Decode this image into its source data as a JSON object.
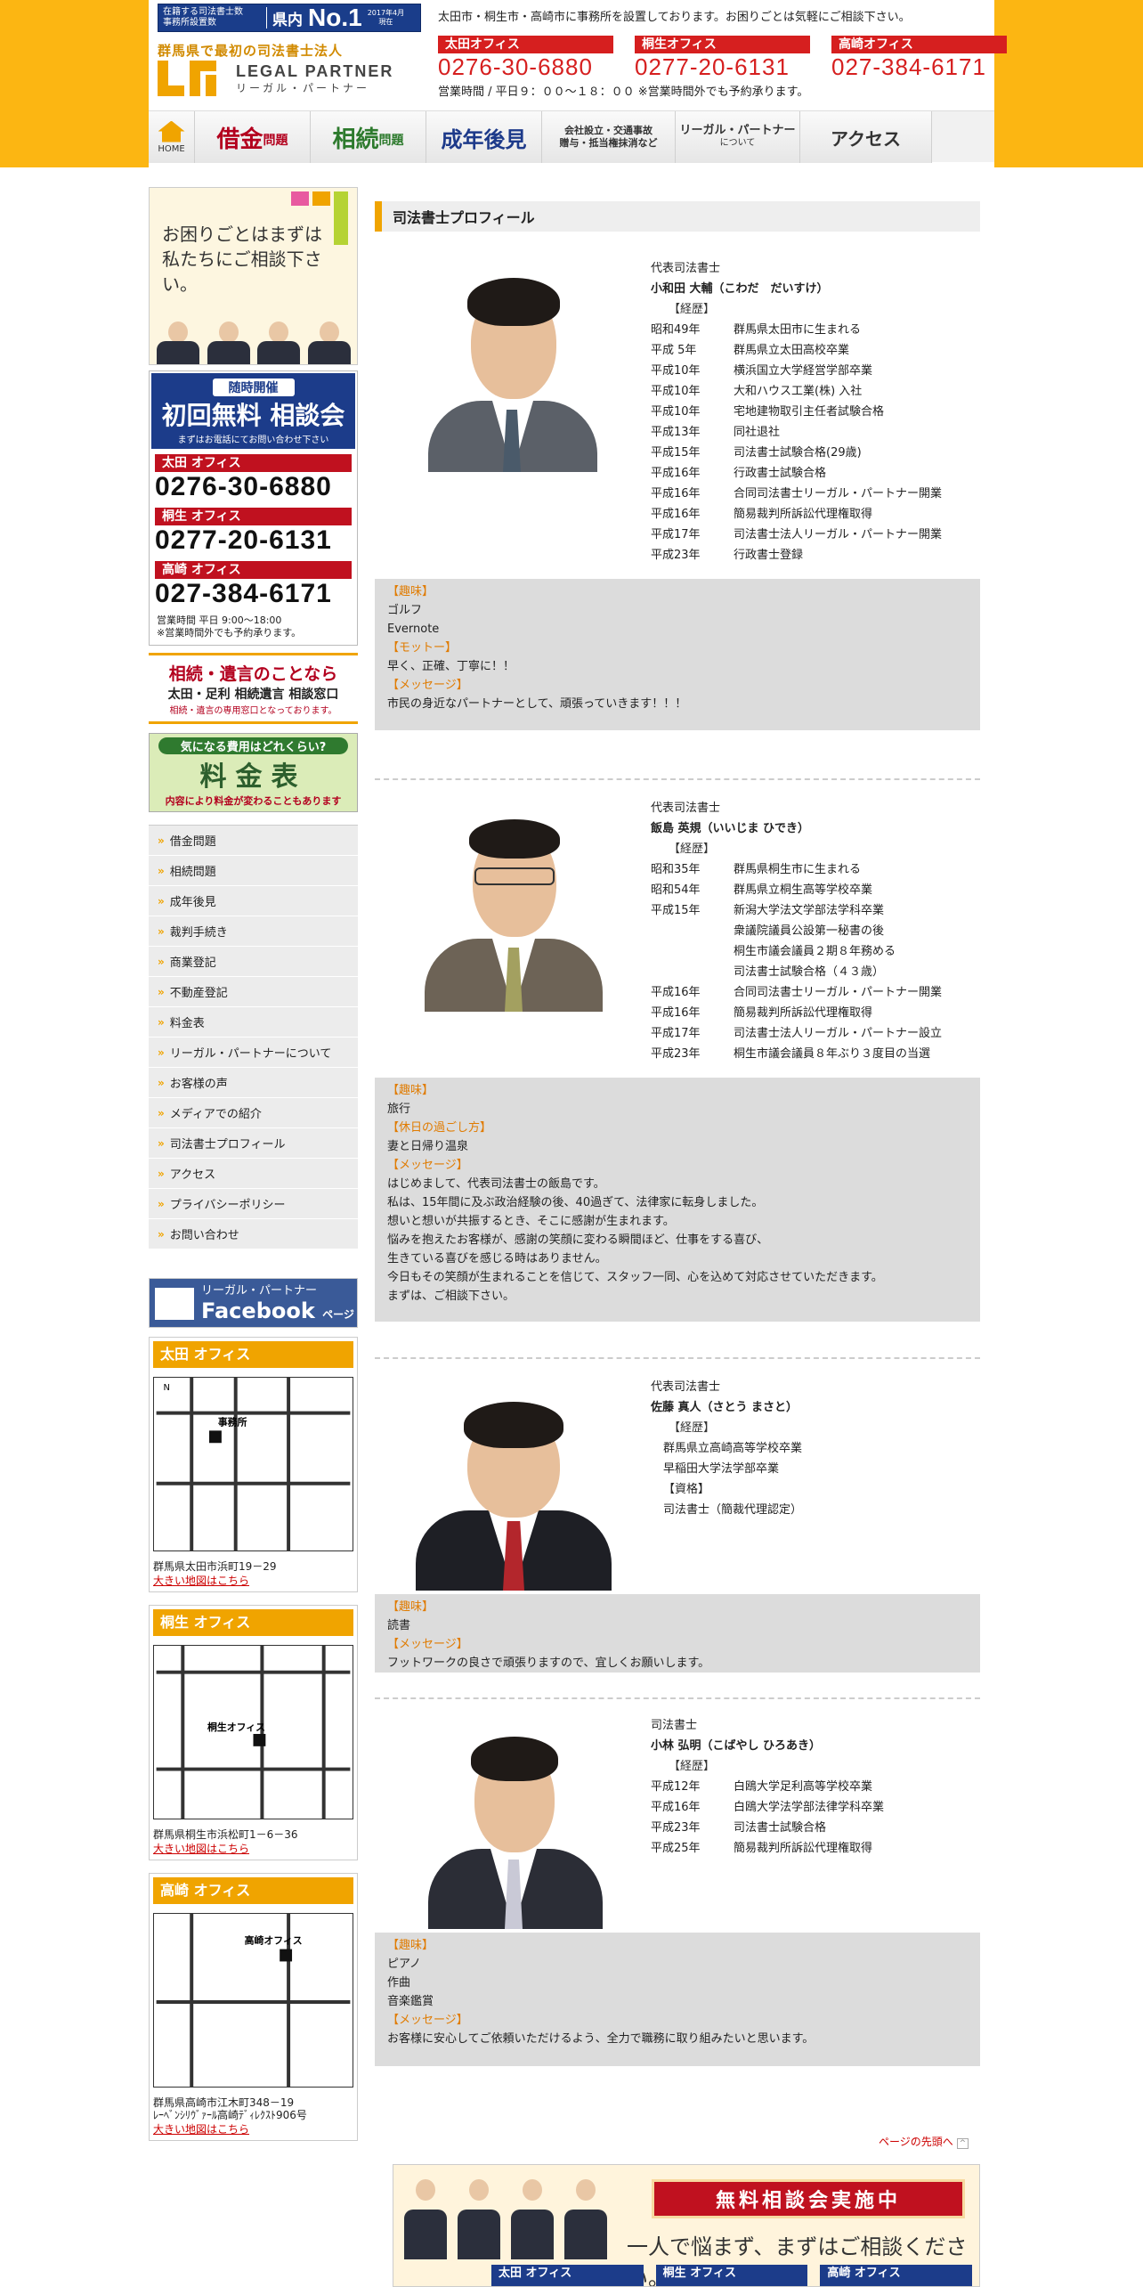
{
  "header": {
    "badge_left": "在籍する司法書士数\n事務所設置数",
    "badge_pref": "県内",
    "badge_no1": "No.1",
    "badge_date": "2017年4月\n現在",
    "tagline": "群馬県で最初の司法書士法人",
    "logo_en": "LEGAL PARTNER",
    "logo_ja": "リーガル・パートナー",
    "notice": "太田市・桐生市・高崎市に事務所を設置しております。お困りごとは気軽にご相談下さい。",
    "offices": [
      {
        "label": "太田オフィス",
        "tel": "0276-30-6880"
      },
      {
        "label": "桐生オフィス",
        "tel": "0277-20-6131"
      },
      {
        "label": "高崎オフィス",
        "tel": "027-384-6171"
      }
    ],
    "hours": "営業時間 / 平日９：００～１８：００ ※営業時間外でも予約承ります。"
  },
  "nav": {
    "home": "HOME",
    "debt": "借金",
    "debt_sub": "問題",
    "inherit": "相続",
    "inherit_sub": "問題",
    "guardian": "成年後見",
    "corp": "会社設立・交通事故\n贈与・抵当権抹消など",
    "about": "リーガル・パートナー",
    "about_sub": "について",
    "access": "アクセス"
  },
  "sidebar": {
    "consult_q": "お困りごとはまずは\n私たちにご相談下さい。",
    "free_a": "随時開催",
    "free_b": "初回無料 相談会",
    "free_c": "まずはお電話にてお問い合わせ下さい",
    "offices": [
      {
        "label": "太田 オフィス",
        "tel": "0276-30-6880"
      },
      {
        "label": "桐生 オフィス",
        "tel": "0277-20-6131"
      },
      {
        "label": "高崎 オフィス",
        "tel": "027-384-6171"
      }
    ],
    "hours": "営業時間 平日 9:00〜18:00\n※営業時間外でも予約承ります。",
    "souzoku_a": "相続・遺言のことなら",
    "souzoku_b": "太田・足利 相続遺言 相談窓口",
    "souzoku_c": "相続・遺言の専用窓口となっております。",
    "fee_a": "気になる費用はどれくらい?",
    "fee_b": "料金表",
    "fee_c": "内容により料金が変わることもあります",
    "menu": [
      "借金問題",
      "相続問題",
      "成年後見",
      "裁判手続き",
      "商業登記",
      "不動産登記",
      "料金表",
      "リーガル・パートナーについて",
      "お客様の声",
      "メディアでの紹介",
      "司法書士プロフィール",
      "アクセス",
      "プライバシーポリシー",
      "お問い合わせ"
    ],
    "fb_a": "リーガル・パートナー",
    "fb_b": "Facebook",
    "fb_c": "ページ",
    "maps": [
      {
        "title": "太田 オフィス",
        "addr": "群馬県太田市浜町19－29",
        "link": "大きい地図はこちら"
      },
      {
        "title": "桐生 オフィス",
        "addr": "群馬県桐生市浜松町1－6－36",
        "link": "大きい地図はこちら"
      },
      {
        "title": "高崎 オフィス",
        "addr": "群馬県高崎市江木町348－19\nﾚｰﾍﾞﾝｼﾘｳﾞｧｰﾙ高崎ﾃﾞｨﾚｸｽﾄ906号",
        "link": "大きい地図はこちら"
      }
    ]
  },
  "main": {
    "title": "司法書士プロフィール",
    "profiles": [
      {
        "role": "代表司法書士",
        "name": "小和田 大輔（こわだ　だいすけ）",
        "hist_label": "【経歴】",
        "history": [
          [
            "昭和49年",
            "群馬県太田市に生まれる"
          ],
          [
            "平成 5年",
            "群馬県立太田高校卒業"
          ],
          [
            "平成10年",
            "横浜国立大学経営学部卒業"
          ],
          [
            "平成10年",
            "大和ハウス工業(株) 入社"
          ],
          [
            "平成10年",
            "宅地建物取引主任者試験合格"
          ],
          [
            "平成13年",
            "同社退社"
          ],
          [
            "平成15年",
            "司法書士試験合格(29歳)"
          ],
          [
            "平成16年",
            "行政書士試験合格"
          ],
          [
            "平成16年",
            "合同司法書士リーガル・パートナー開業"
          ],
          [
            "平成16年",
            "簡易裁判所訴訟代理権取得"
          ],
          [
            "平成17年",
            "司法書士法人リーガル・パートナー開業"
          ],
          [
            "平成23年",
            "行政書士登録"
          ]
        ],
        "extra": [
          {
            "k": "【趣味】"
          },
          {
            "v": "ゴルフ"
          },
          {
            "v": "Evernote"
          },
          {
            "k": "【モットー】"
          },
          {
            "v": "早く、正確、丁寧に！！"
          },
          {
            "k": "【メッセージ】"
          },
          {
            "v": "市民の身近なパートナーとして、頑張っていきます！！！"
          }
        ]
      },
      {
        "role": "代表司法書士",
        "name": "飯島 英規（いいじま ひでき）",
        "hist_label": "【経歴】",
        "history": [
          [
            "昭和35年",
            "群馬県桐生市に生まれる"
          ],
          [
            "昭和54年",
            "群馬県立桐生高等学校卒業"
          ],
          [
            "平成15年",
            "新潟大学法文学部法学科卒業"
          ],
          [
            "",
            "衆議院議員公設第一秘書の後"
          ],
          [
            "",
            "桐生市議会議員２期８年務める"
          ],
          [
            "",
            "司法書士試験合格（４３歳）"
          ],
          [
            "平成16年",
            "合同司法書士リーガル・パートナー開業"
          ],
          [
            "平成16年",
            "簡易裁判所訴訟代理権取得"
          ],
          [
            "平成17年",
            "司法書士法人リーガル・パートナー設立"
          ],
          [
            "平成23年",
            "桐生市議会議員８年ぶり３度目の当選"
          ]
        ],
        "extra": [
          {
            "k": "【趣味】"
          },
          {
            "v": "旅行"
          },
          {
            "k": "【休日の過ごし方】"
          },
          {
            "v": "妻と日帰り温泉"
          },
          {
            "k": "【メッセージ】"
          },
          {
            "v": "はじめまして、代表司法書士の飯島です。"
          },
          {
            "v": "私は、15年間に及ぶ政治経験の後、40過ぎて、法律家に転身しました。"
          },
          {
            "v": "想いと想いが共振するとき、そこに感謝が生まれます。"
          },
          {
            "v": "悩みを抱えたお客様が、感謝の笑顔に変わる瞬間ほど、仕事をする喜び、"
          },
          {
            "v": "生きている喜びを感じる時はありません。"
          },
          {
            "v": "今日もその笑顔が生まれることを信じて、スタッフ一同、心を込めて対応させていただきます。"
          },
          {
            "v": "まずは、ご相談下さい。"
          }
        ]
      },
      {
        "role": "代表司法書士",
        "name": "佐藤 真人（さとう まさと）",
        "hist_label": "【経歴】",
        "history": [
          [
            "",
            "群馬県立高崎高等学校卒業"
          ],
          [
            "",
            "早稲田大学法学部卒業"
          ],
          [
            "",
            "【資格】"
          ],
          [
            "",
            "司法書士（簡裁代理認定）"
          ]
        ],
        "extra": [
          {
            "k": "【趣味】"
          },
          {
            "v": "読書"
          },
          {
            "k": "【メッセージ】"
          },
          {
            "v": "フットワークの良さで頑張りますので、宜しくお願いします。"
          }
        ]
      },
      {
        "role": "司法書士",
        "name": "小林 弘明（こばやし ひろあき）",
        "hist_label": "【経歴】",
        "history": [
          [
            "平成12年",
            "白鴎大学足利高等学校卒業"
          ],
          [
            "平成16年",
            "白鴎大学法学部法律学科卒業"
          ],
          [
            "平成23年",
            "司法書士試験合格"
          ],
          [
            "平成25年",
            "簡易裁判所訴訟代理権取得"
          ]
        ],
        "extra": [
          {
            "k": "【趣味】"
          },
          {
            "v": "ピアノ"
          },
          {
            "v": "作曲"
          },
          {
            "v": "音楽鑑賞"
          },
          {
            "k": "【メッセージ】"
          },
          {
            "v": "お客様に安心してご依頼いただけるよう、全力で職務に取り組みたいと思います。"
          }
        ]
      }
    ],
    "pagetop": "ページの先頭へ",
    "banner_free": "無料相談会実施中",
    "banner_msg": "一人で悩まず、まずはご相談ください。",
    "banner_offices": [
      "太田 オフィス",
      "桐生 オフィス",
      "高崎 オフィス"
    ]
  },
  "colors": {
    "accent": "#fcb612",
    "red": "#c0111f",
    "navy": "#1c3c8a"
  }
}
